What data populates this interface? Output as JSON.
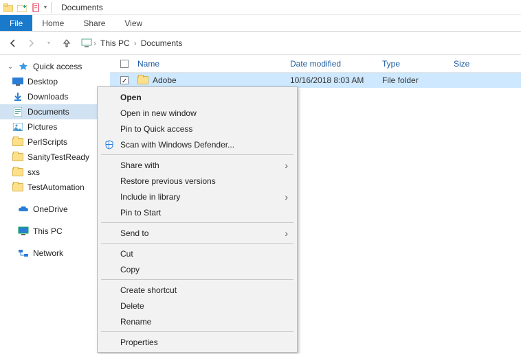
{
  "title": "Documents",
  "ribbon": {
    "file": "File",
    "home": "Home",
    "share": "Share",
    "view": "View"
  },
  "breadcrumb": {
    "seg1": "This PC",
    "seg2": "Documents"
  },
  "columns": {
    "name": "Name",
    "date": "Date modified",
    "type": "Type",
    "size": "Size"
  },
  "sidebar": {
    "quick_access": "Quick access",
    "items": [
      {
        "label": "Desktop"
      },
      {
        "label": "Downloads"
      },
      {
        "label": "Documents"
      },
      {
        "label": "Pictures"
      },
      {
        "label": "PerlScripts"
      },
      {
        "label": "SanityTestReady"
      },
      {
        "label": "sxs"
      },
      {
        "label": "TestAutomation"
      }
    ],
    "onedrive": "OneDrive",
    "this_pc": "This PC",
    "network": "Network"
  },
  "rows": [
    {
      "name": "Adobe",
      "date": "10/16/2018 8:03 AM",
      "type": "File folder",
      "size": ""
    }
  ],
  "context_menu": {
    "open": "Open",
    "open_new_window": "Open in new window",
    "pin_quick": "Pin to Quick access",
    "defender": "Scan with Windows Defender...",
    "share_with": "Share with",
    "restore_prev": "Restore previous versions",
    "include_lib": "Include in library",
    "pin_start": "Pin to Start",
    "send_to": "Send to",
    "cut": "Cut",
    "copy": "Copy",
    "create_shortcut": "Create shortcut",
    "delete": "Delete",
    "rename": "Rename",
    "properties": "Properties"
  }
}
